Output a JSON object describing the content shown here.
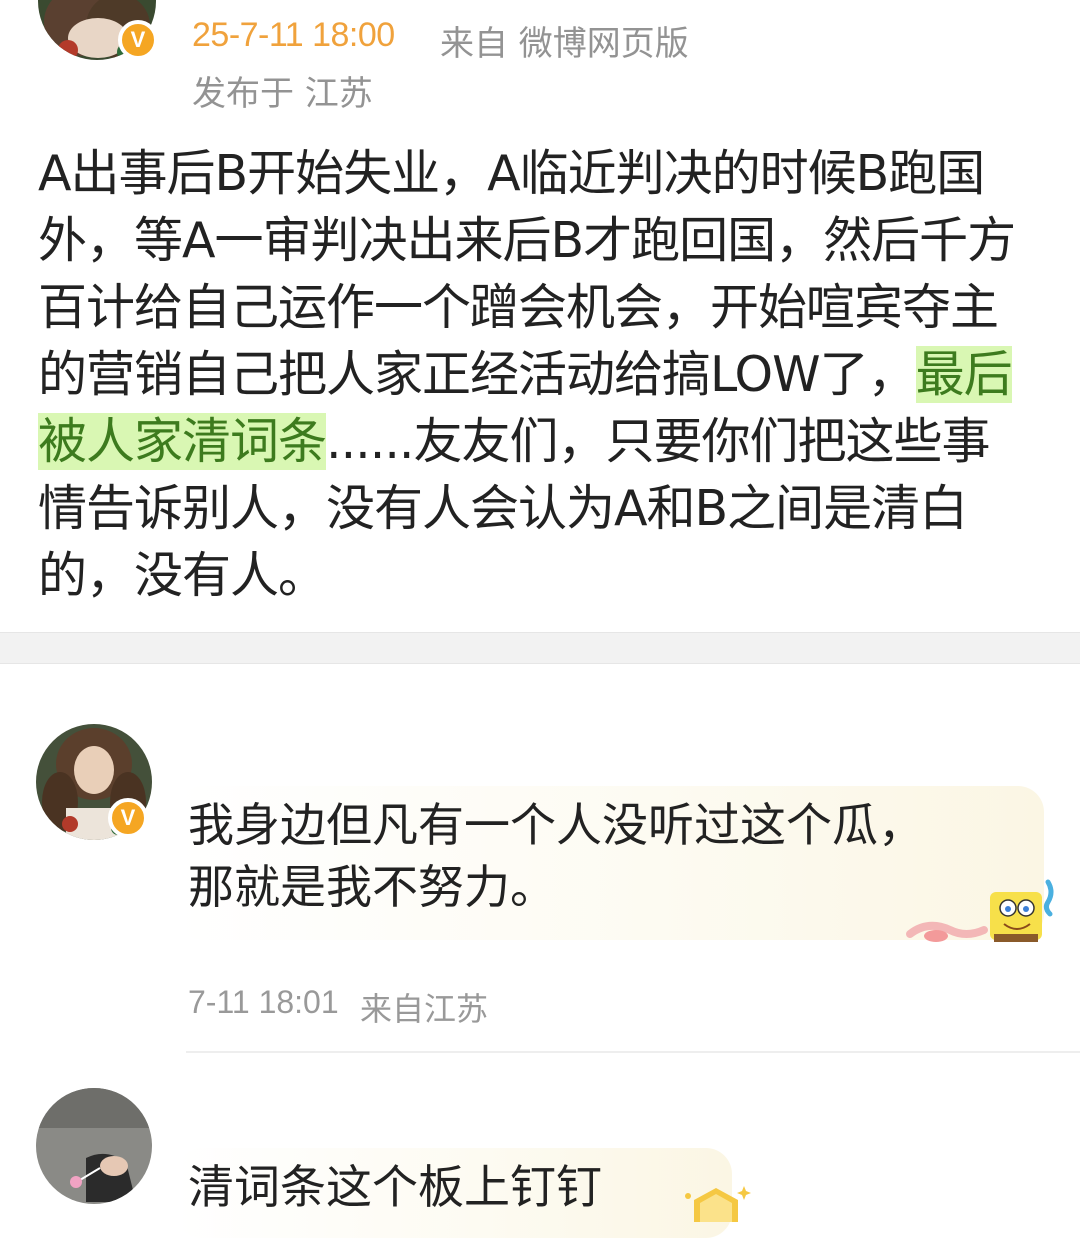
{
  "post": {
    "time": "25-7-11 18:00",
    "source": "来自 微博网页版",
    "location": "发布于 江苏",
    "body_before": "A出事后B开始失业，A临近判决的时候B跑国外，等A一审判决出来后B才跑回国，然后千方百计给自己运作一个蹭会机会，开始喧宾夺主的营销自己把人家正经活动给搞LOW了，",
    "body_highlight": "最后被人家清词条",
    "body_after": "......友友们，只要你们把这些事情告诉别人，没有人会认为A和B之间是清白的，没有人。"
  },
  "comments": [
    {
      "text_line1": "我身边但凡有一个人没听过这个瓜，",
      "text_line2": "那就是我不努力。",
      "time": "7-11 18:01",
      "source": "来自江苏"
    },
    {
      "text_line1": "清词条这个板上钉钉"
    }
  ],
  "badge": {
    "symbol": "V"
  },
  "colors": {
    "time_accent": "#f0a23c",
    "meta_gray": "#939393",
    "highlight_bg": "#d9f7b3",
    "highlight_text": "#3d7b1e",
    "verified_badge": "#f5a623"
  },
  "icons": [
    "verified-badge-icon",
    "spongebob-sticker",
    "gold-badge-sticker"
  ]
}
